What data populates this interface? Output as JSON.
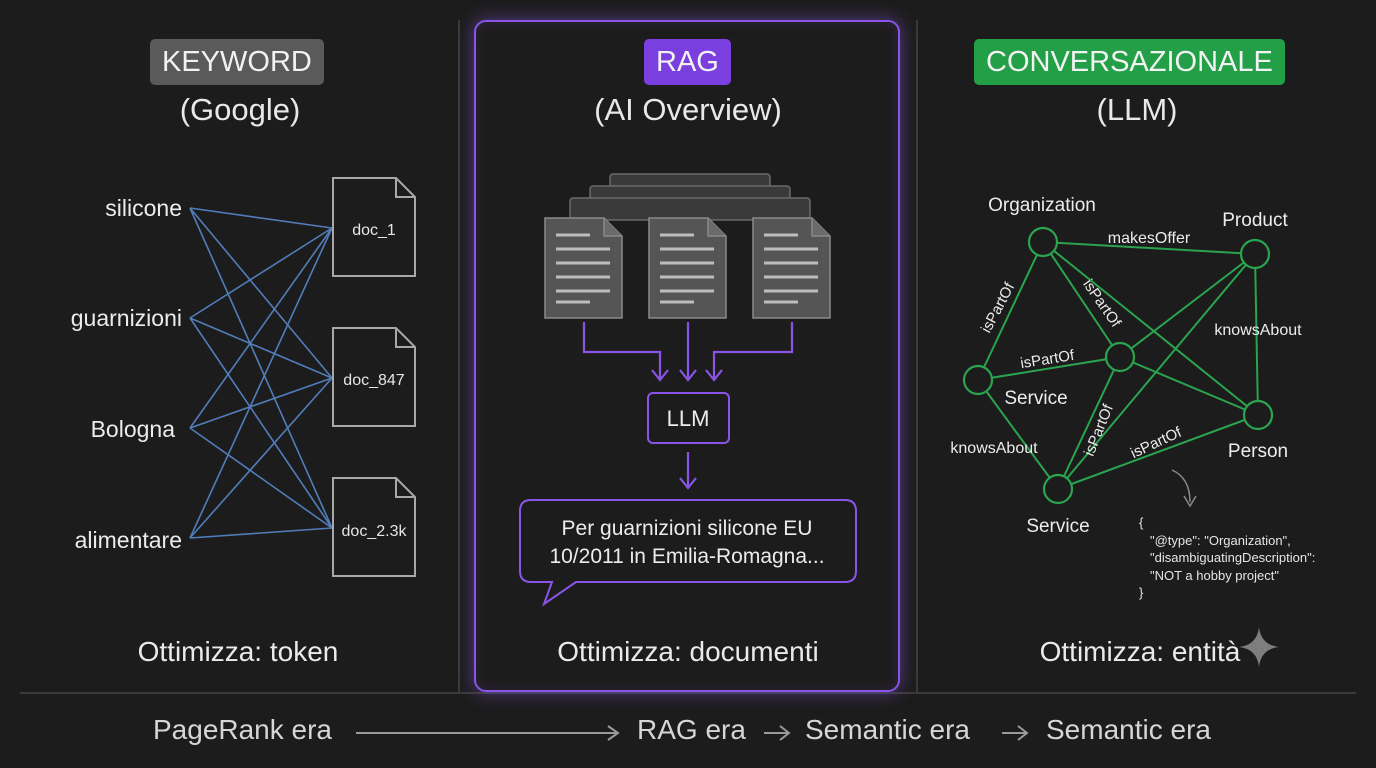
{
  "keyword": {
    "badge": "KEYWORD",
    "subtitle": "(Google)",
    "terms": [
      "silicone",
      "guarnizioni",
      "Bologna",
      "alimentare"
    ],
    "docs": [
      "doc_1",
      "doc_847",
      "doc_2.3k"
    ],
    "optimize": "Ottimizza: token",
    "badge_color": "#5a5a5a",
    "line_color": "#5b8fd6"
  },
  "rag": {
    "badge": "RAG",
    "subtitle": "(AI Overview)",
    "llm": "LLM",
    "answer_line1": "Per guarnizioni silicone EU",
    "answer_line2": "10/2011 in Emilia-Romagna...",
    "optimize": "Ottimizza: documenti",
    "accent": "#8a55e6"
  },
  "conversational": {
    "badge": "CONVERSAZIONALE",
    "subtitle": "(LLM)",
    "nodes": [
      "Organization",
      "Product",
      "Service",
      "Person",
      "Service"
    ],
    "edges": [
      "makesOffer",
      "isPartOf",
      "isPartOf",
      "knowsAbout",
      "isPartOf",
      "knowsAbout",
      "isPartOf",
      "isPartOf"
    ],
    "json_lines": [
      "{",
      "\"@type\": \"Organization\",",
      "\"disambiguatingDescription\":",
      "\"NOT a hobby project\"",
      "}"
    ],
    "optimize": "Ottimizza: entità",
    "accent": "#2aa44f"
  },
  "timeline": {
    "eras": [
      "PageRank era",
      "RAG era",
      "Semantic era",
      "Semantic era"
    ]
  }
}
